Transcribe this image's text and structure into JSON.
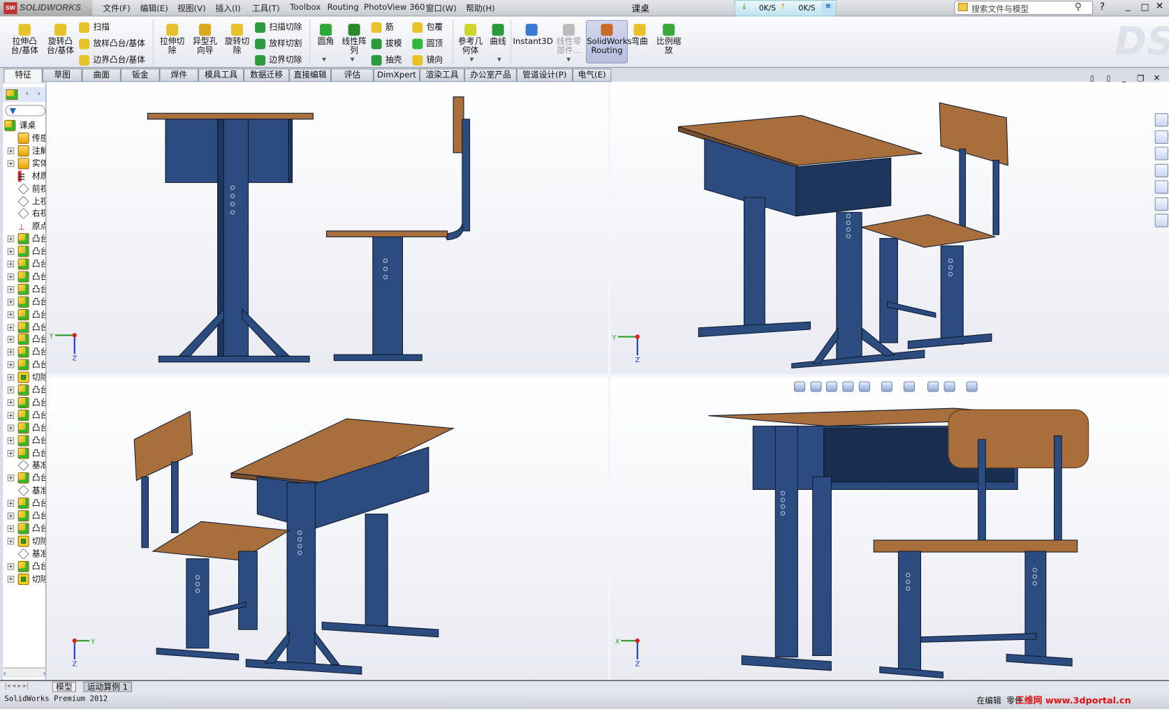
{
  "app": {
    "brand": "SOLIDWORKS",
    "title": "课桌"
  },
  "menu": [
    "文件(F)",
    "编辑(E)",
    "视图(V)",
    "插入(I)",
    "工具(T)",
    "Toolbox",
    "Routing",
    "PhotoView 360",
    "窗口(W)",
    "帮助(H)"
  ],
  "net": {
    "down": "0K/S",
    "up": "0K/S"
  },
  "search": {
    "placeholder": "搜索文件与模型"
  },
  "ribbon": {
    "big": [
      "拉伸凸台/基体",
      "旋转凸台/基体",
      "拉伸切除",
      "异型孔向导",
      "旋转切除",
      "圆角",
      "线性阵列",
      "参考几何体",
      "曲线",
      "Instant3D",
      "线性零部件...",
      "SolidWorks Routing",
      "弯曲",
      "比例缩放"
    ],
    "small": [
      "扫描",
      "放样凸台/基体",
      "边界凸台/基体",
      "扫描切除",
      "放样切割",
      "边界切除",
      "筋",
      "拔模",
      "抽壳",
      "包覆",
      "圆顶",
      "镜向"
    ]
  },
  "tabs": [
    "特征",
    "草图",
    "曲面",
    "钣金",
    "焊件",
    "模具工具",
    "数据迁移",
    "直接编辑",
    "评估",
    "DimXpert",
    "渲染工具",
    "办公室产品",
    "管道设计(P)",
    "电气(E)"
  ],
  "tree": {
    "root": "课桌",
    "items": [
      "传感",
      "注解",
      "实体",
      "材质",
      "前视",
      "上视",
      "右视",
      "原点",
      "凸台",
      "凸台",
      "凸台",
      "凸台",
      "凸台",
      "凸台",
      "凸台",
      "凸台",
      "凸台",
      "凸台",
      "凸台",
      "切除",
      "凸台",
      "凸台",
      "凸台",
      "凸台",
      "凸台",
      "凸台",
      "基准",
      "凸台",
      "基准",
      "凸台",
      "凸台",
      "凸台",
      "切除",
      "基准",
      "凸台",
      "切除"
    ],
    "types": [
      "folder",
      "folder",
      "folder",
      "material",
      "plane",
      "plane",
      "plane",
      "origin",
      "boss",
      "boss",
      "boss",
      "boss",
      "boss",
      "boss",
      "boss",
      "boss",
      "boss",
      "boss",
      "boss",
      "cut",
      "boss",
      "boss",
      "boss",
      "boss",
      "boss",
      "boss",
      "plane",
      "boss",
      "plane",
      "boss",
      "boss",
      "boss",
      "cut",
      "plane",
      "boss",
      "cut"
    ],
    "expandable": [
      false,
      true,
      true,
      false,
      false,
      false,
      false,
      false,
      true,
      true,
      true,
      true,
      true,
      true,
      true,
      true,
      true,
      true,
      true,
      true,
      true,
      true,
      true,
      true,
      true,
      true,
      false,
      true,
      false,
      true,
      true,
      true,
      true,
      false,
      true,
      true
    ]
  },
  "axes": {
    "x": "X",
    "y": "Y",
    "z": "Z"
  },
  "bottom_tabs": [
    "模型",
    "运动算例 1"
  ],
  "status": {
    "left": "SolidWorks Premium 2012",
    "editing": "在编辑",
    "mode": "零件",
    "watermark": "三维网 www.3dportal.cn"
  },
  "colors": {
    "frame": "#2c4c80",
    "wood": "#a86f3c",
    "accent": "#2b5fb0"
  }
}
